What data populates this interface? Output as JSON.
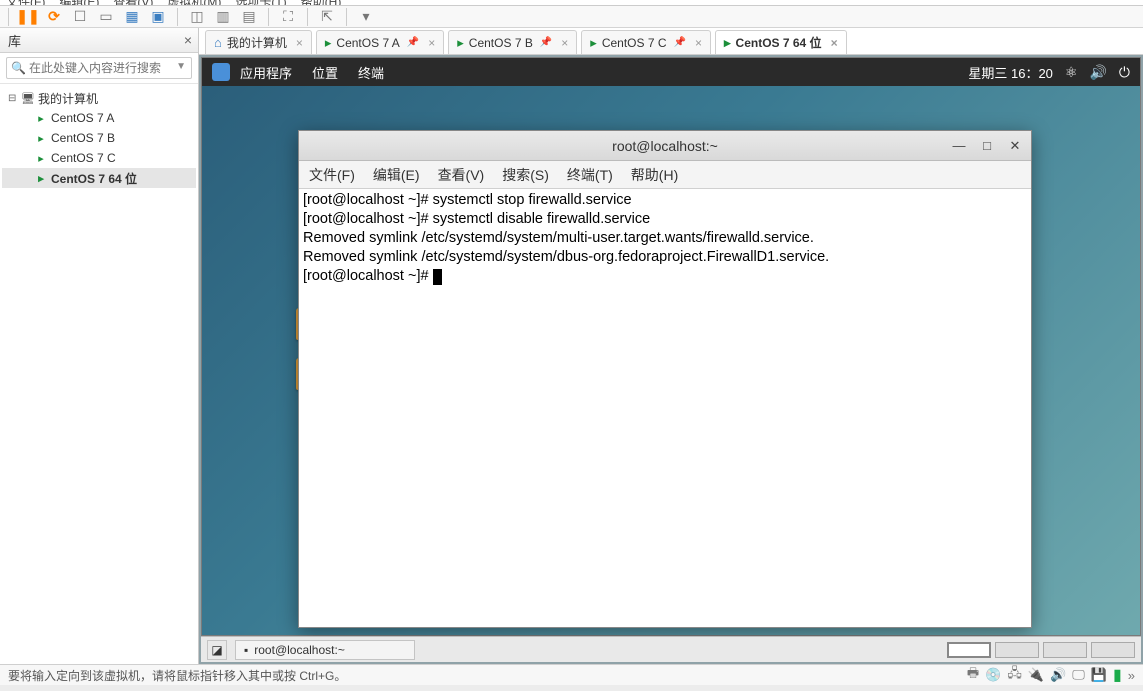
{
  "host_menu": [
    "文件(F)",
    "编辑(E)",
    "查看(V)",
    "虚拟机(M)",
    "选项卡(T)",
    "帮助(H)"
  ],
  "sidebar": {
    "title": "库",
    "search_placeholder": "在此处键入内容进行搜索",
    "root": "我的计算机",
    "items": [
      {
        "label": "CentOS 7 A"
      },
      {
        "label": "CentOS 7 B"
      },
      {
        "label": "CentOS 7 C"
      },
      {
        "label": "CentOS 7 64 位",
        "selected": true
      }
    ]
  },
  "tabs": [
    {
      "label": "我的计算机",
      "icon": "home",
      "close": true
    },
    {
      "label": "CentOS 7 A",
      "icon": "vm",
      "close": true,
      "pin": true
    },
    {
      "label": "CentOS 7 B",
      "icon": "vm",
      "close": true,
      "pin": true
    },
    {
      "label": "CentOS 7 C",
      "icon": "vm",
      "close": true,
      "pin": true
    },
    {
      "label": "CentOS 7 64 位",
      "icon": "vm",
      "close": true,
      "active": true
    }
  ],
  "gnome": {
    "apps": "应用程序",
    "places": "位置",
    "terminal": "终端",
    "clock": "星期三 16：20"
  },
  "terminal": {
    "title": "root@localhost:~",
    "menu": [
      "文件(F)",
      "编辑(E)",
      "查看(V)",
      "搜索(S)",
      "终端(T)",
      "帮助(H)"
    ],
    "lines": [
      "[root@localhost ~]# systemctl stop firewalld.service",
      "[root@localhost ~]# systemctl disable firewalld.service",
      "Removed symlink /etc/systemd/system/multi-user.target.wants/firewalld.service.",
      "Removed symlink /etc/systemd/system/dbus-org.fedoraproject.FirewallD1.service.",
      "[root@localhost ~]# "
    ]
  },
  "taskbar": {
    "item": "root@localhost:~"
  },
  "statusbar": {
    "hint": "要将输入定向到该虚拟机，请将鼠标指针移入其中或按 Ctrl+G。"
  }
}
